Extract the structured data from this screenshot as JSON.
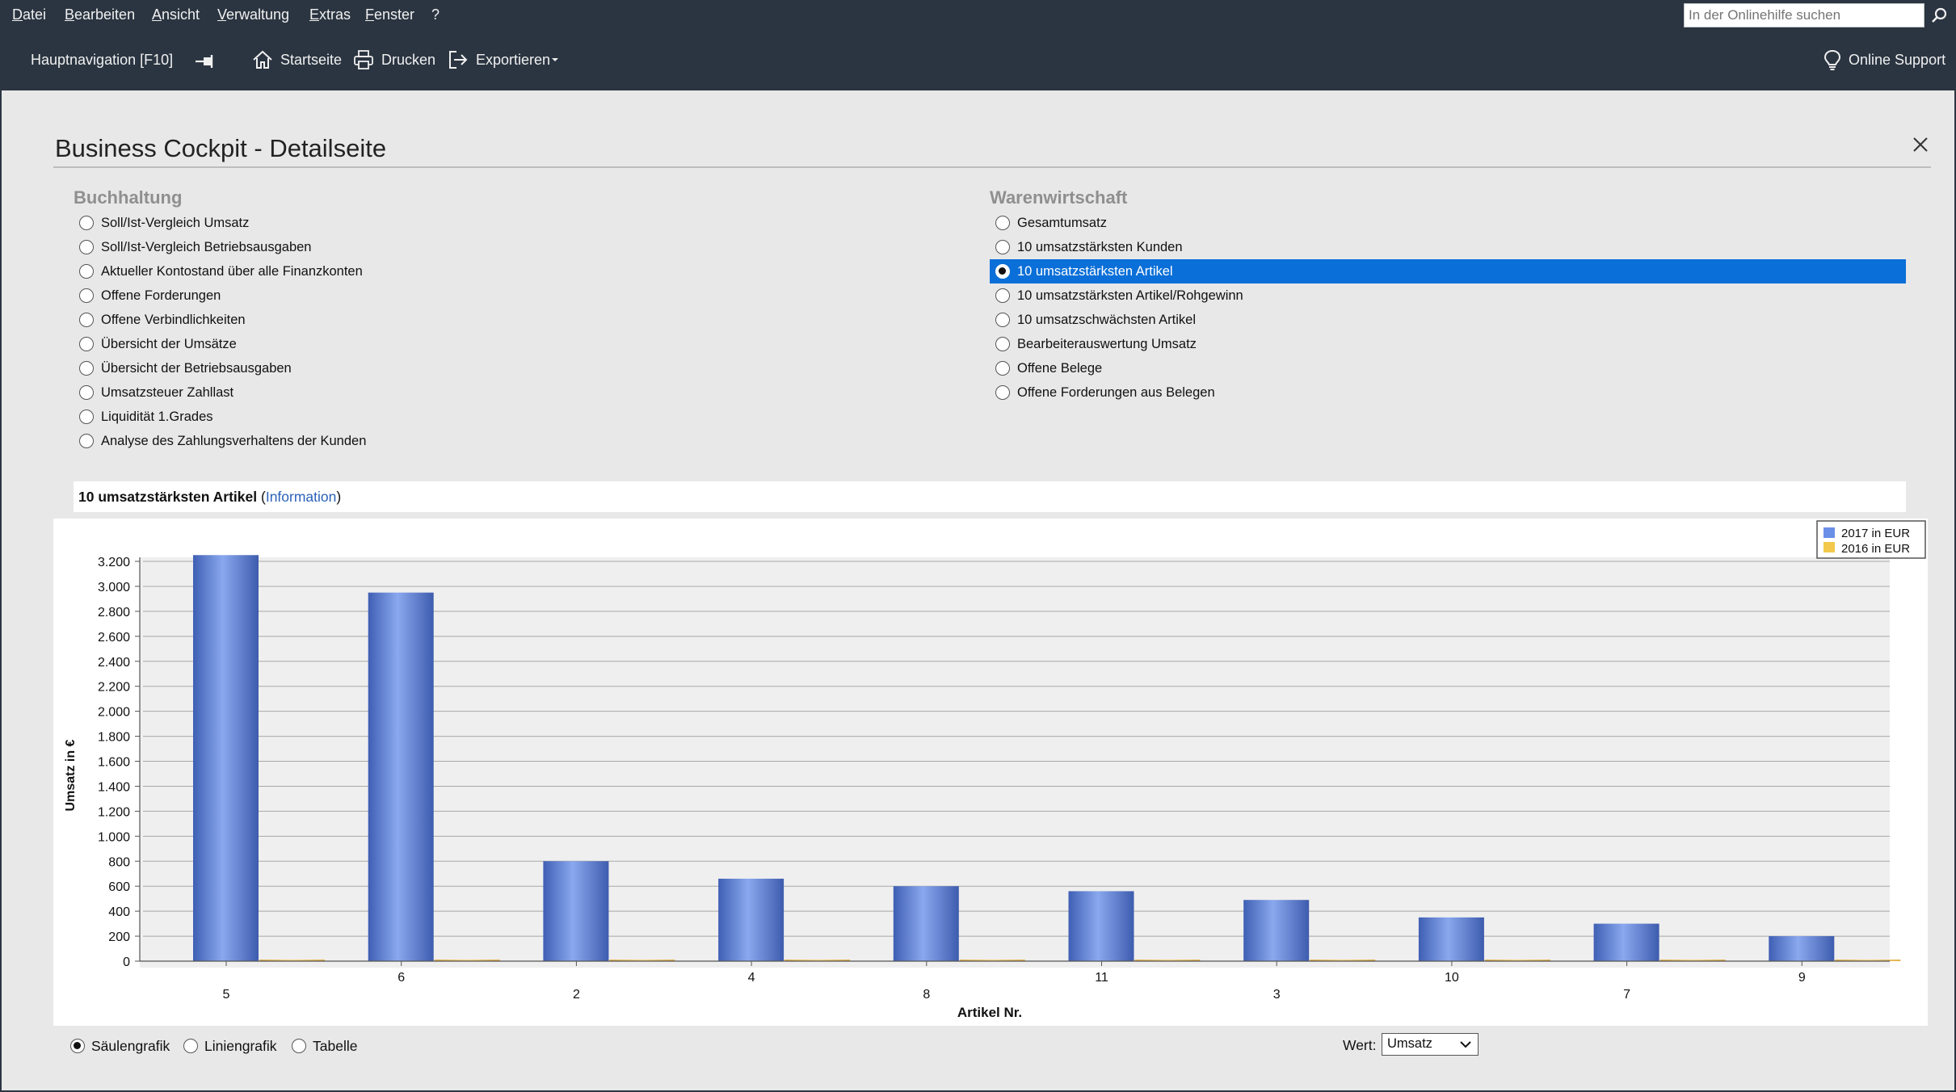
{
  "menu": [
    "Datei",
    "Bearbeiten",
    "Ansicht",
    "Verwaltung",
    "Extras",
    "Fenster",
    "?"
  ],
  "search": {
    "placeholder": "In der Onlinehilfe suchen"
  },
  "toolbar": {
    "main_nav": "Hauptnavigation [F10]",
    "home": "Startseite",
    "print": "Drucken",
    "export": "Exportieren",
    "support": "Online Support"
  },
  "page": {
    "title": "Business Cockpit - Detailseite"
  },
  "buchhaltung": {
    "title": "Buchhaltung",
    "items": [
      "Soll/Ist-Vergleich Umsatz",
      "Soll/Ist-Vergleich Betriebsausgaben",
      "Aktueller Kontostand über alle Finanzkonten",
      "Offene Forderungen",
      "Offene Verbindlichkeiten",
      "Übersicht der Umsätze",
      "Übersicht der Betriebsausgaben",
      "Umsatzsteuer Zahllast",
      "Liquidität 1.Grades",
      "Analyse des Zahlungsverhaltens der Kunden"
    ]
  },
  "warenwirtschaft": {
    "title": "Warenwirtschaft",
    "selected_index": 2,
    "items": [
      "Gesamtumsatz",
      "10 umsatzstärksten Kunden",
      "10 umsatzstärksten Artikel",
      "10 umsatzstärksten Artikel/Rohgewinn",
      "10 umsatzschwächsten Artikel",
      "Bearbeiterauswertung Umsatz",
      "Offene Belege",
      "Offene Forderungen aus Belegen"
    ]
  },
  "chart_header": {
    "title": "10 umsatzstärksten Artikel",
    "open": "(",
    "link": "Information",
    "close": ")"
  },
  "chart_data": {
    "type": "bar",
    "categories": [
      "5",
      "6",
      "2",
      "4",
      "8",
      "11",
      "3",
      "10",
      "7",
      "9"
    ],
    "series": [
      {
        "name": "2017 in EUR",
        "color": "#5b80d6",
        "values": [
          3250,
          2950,
          800,
          660,
          600,
          560,
          490,
          350,
          300,
          200
        ]
      },
      {
        "name": "2016 in EUR",
        "color": "#f2c94c",
        "values": [
          0,
          0,
          0,
          0,
          0,
          0,
          0,
          0,
          0,
          0
        ]
      }
    ],
    "xlabel": "Artikel Nr.",
    "ylabel": "Umsatz in €",
    "ylim": [
      0,
      3300
    ],
    "yticks": [
      "0",
      "200",
      "400",
      "600",
      "800",
      "1.000",
      "1.200",
      "1.400",
      "1.600",
      "1.800",
      "2.000",
      "2.200",
      "2.400",
      "2.600",
      "2.800",
      "3.000",
      "3.200"
    ],
    "legend_position": "top-right",
    "grid": true
  },
  "view_options": {
    "selected_index": 0,
    "items": [
      "Säulengrafik",
      "Liniengrafik",
      "Tabelle"
    ]
  },
  "wert": {
    "label": "Wert:",
    "value": "Umsatz"
  }
}
